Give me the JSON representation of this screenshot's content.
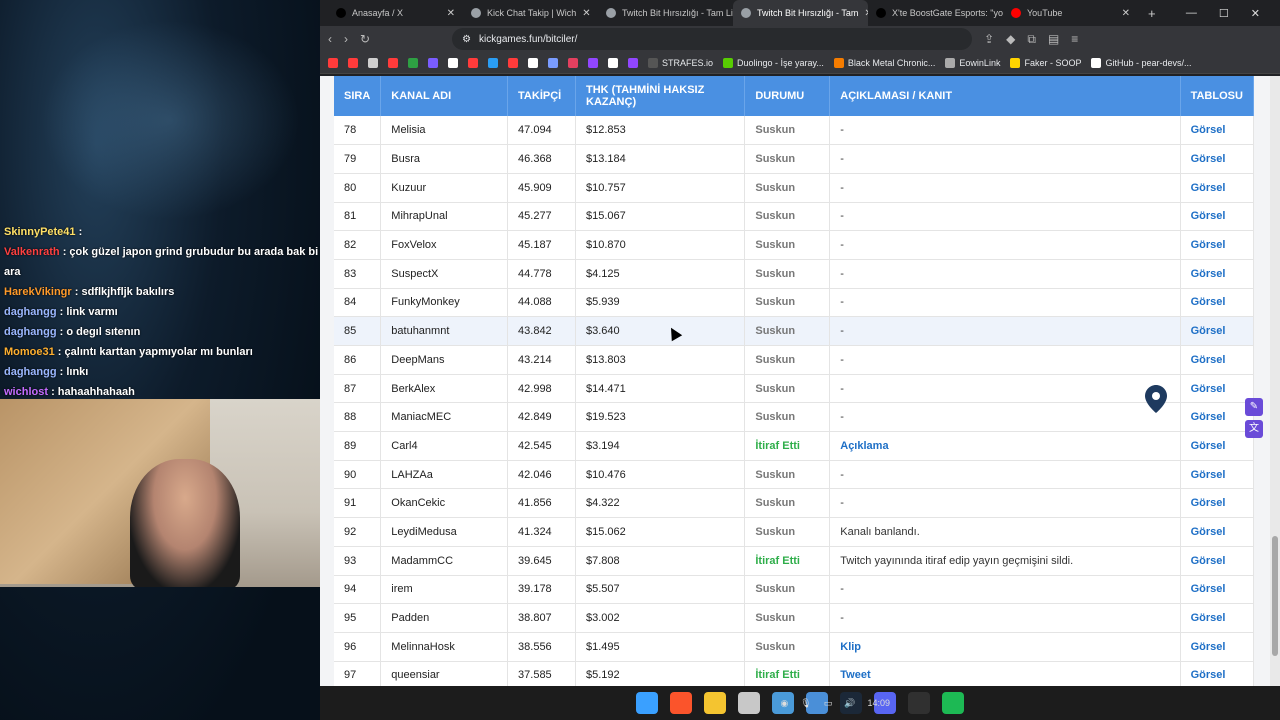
{
  "chat": [
    {
      "user": "SkinnyPete41",
      "color": "#ffe066",
      "msg": ""
    },
    {
      "user": "Valkenrath",
      "color": "#ff4040",
      "msg": "çok güzel japon grind grubudur bu arada bak bi ara"
    },
    {
      "user": "HarekVikingr",
      "color": "#ff9a2a",
      "msg": "sdflkjhfljk bakılırs"
    },
    {
      "user": "daghangg",
      "color": "#9bb7ff",
      "msg": "link varmı"
    },
    {
      "user": "daghangg",
      "color": "#9bb7ff",
      "msg": "o degıl sıtenın"
    },
    {
      "user": "Momoe31",
      "color": "#ffb030",
      "msg": "çalıntı karttan yapmıyolar mı bunları"
    },
    {
      "user": "daghangg",
      "color": "#9bb7ff",
      "msg": "lınkı"
    },
    {
      "user": "wichlost",
      "color": "#c56bff",
      "msg": "hahaahhahaah"
    }
  ],
  "browser": {
    "tabs": [
      {
        "title": "Anasayfa / X",
        "color": "#000000",
        "active": false
      },
      {
        "title": "Kick Chat Takip | Wich",
        "color": "#9aa0a6",
        "active": false
      },
      {
        "title": "Twitch Bit Hırsızlığı - Tam List",
        "color": "#9aa0a6",
        "active": false
      },
      {
        "title": "Twitch Bit Hırsızlığı - Tam",
        "color": "#9aa0a6",
        "active": true
      },
      {
        "title": "X'te BoostGate Esports: \"yok",
        "color": "#000000",
        "active": false
      },
      {
        "title": "YouTube",
        "color": "#ff0000",
        "active": false
      }
    ],
    "url": "kickgames.fun/bitciler/",
    "bookmarks": [
      {
        "label": "",
        "color": "#ff3b3b"
      },
      {
        "label": "",
        "color": "#ff3b3b"
      },
      {
        "label": "",
        "color": "#cfcfcf"
      },
      {
        "label": "",
        "color": "#ff3b3b"
      },
      {
        "label": "",
        "color": "#2ea043"
      },
      {
        "label": "",
        "color": "#7a5cff"
      },
      {
        "label": "",
        "color": "#ffffff"
      },
      {
        "label": "",
        "color": "#ff3b3b"
      },
      {
        "label": "",
        "color": "#2a9df4"
      },
      {
        "label": "",
        "color": "#ff3b3b"
      },
      {
        "label": "",
        "color": "#ffffff"
      },
      {
        "label": "",
        "color": "#7a9cff"
      },
      {
        "label": "",
        "color": "#e4405f"
      },
      {
        "label": "",
        "color": "#9146ff"
      },
      {
        "label": "",
        "color": "#ffffff"
      },
      {
        "label": "",
        "color": "#9146ff"
      },
      {
        "label": "STRAFES.io",
        "color": "#555555"
      },
      {
        "label": "Duolingo - İşe yaray...",
        "color": "#58cc02"
      },
      {
        "label": "Black Metal Chronic...",
        "color": "#f57c00"
      },
      {
        "label": "EowinLink",
        "color": "#aaaaaa"
      },
      {
        "label": "Faker - SOOP",
        "color": "#ffd400"
      },
      {
        "label": "GitHub - pear-devs/...",
        "color": "#ffffff"
      }
    ]
  },
  "table": {
    "headers": [
      "SIRA",
      "KANAL ADI",
      "TAKİPÇİ",
      "THK (TAHMİNİ HAKSIZ KAZANÇ)",
      "DURUMU",
      "AÇIKLAMASI / KANIT",
      "TABLOSU"
    ],
    "rows": [
      {
        "sira": "78",
        "kanal": "Melisia",
        "takipci": "47.094",
        "thk": "$12.853",
        "durum": "Suskun",
        "aciklama": "-",
        "tablo": "Görsel"
      },
      {
        "sira": "79",
        "kanal": "Busra",
        "takipci": "46.368",
        "thk": "$13.184",
        "durum": "Suskun",
        "aciklama": "-",
        "tablo": "Görsel"
      },
      {
        "sira": "80",
        "kanal": "Kuzuur",
        "takipci": "45.909",
        "thk": "$10.757",
        "durum": "Suskun",
        "aciklama": "-",
        "tablo": "Görsel"
      },
      {
        "sira": "81",
        "kanal": "MihrapUnal",
        "takipci": "45.277",
        "thk": "$15.067",
        "durum": "Suskun",
        "aciklama": "-",
        "tablo": "Görsel"
      },
      {
        "sira": "82",
        "kanal": "FoxVelox",
        "takipci": "45.187",
        "thk": "$10.870",
        "durum": "Suskun",
        "aciklama": "-",
        "tablo": "Görsel"
      },
      {
        "sira": "83",
        "kanal": "SuspectX",
        "takipci": "44.778",
        "thk": "$4.125",
        "durum": "Suskun",
        "aciklama": "-",
        "tablo": "Görsel"
      },
      {
        "sira": "84",
        "kanal": "FunkyMonkey",
        "takipci": "44.088",
        "thk": "$5.939",
        "durum": "Suskun",
        "aciklama": "-",
        "tablo": "Görsel"
      },
      {
        "sira": "85",
        "kanal": "batuhanmnt",
        "takipci": "43.842",
        "thk": "$3.640",
        "durum": "Suskun",
        "aciklama": "-",
        "tablo": "Görsel",
        "highlight": true
      },
      {
        "sira": "86",
        "kanal": "DeepMans",
        "takipci": "43.214",
        "thk": "$13.803",
        "durum": "Suskun",
        "aciklama": "-",
        "tablo": "Görsel"
      },
      {
        "sira": "87",
        "kanal": "BerkAlex",
        "takipci": "42.998",
        "thk": "$14.471",
        "durum": "Suskun",
        "aciklama": "-",
        "tablo": "Görsel"
      },
      {
        "sira": "88",
        "kanal": "ManiacMEC",
        "takipci": "42.849",
        "thk": "$19.523",
        "durum": "Suskun",
        "aciklama": "-",
        "tablo": "Görsel"
      },
      {
        "sira": "89",
        "kanal": "Carl4",
        "takipci": "42.545",
        "thk": "$3.194",
        "durum": "İtiraf Etti",
        "aciklama": "Açıklama",
        "aciklama_link": true,
        "tablo": "Görsel"
      },
      {
        "sira": "90",
        "kanal": "LAHZAa",
        "takipci": "42.046",
        "thk": "$10.476",
        "durum": "Suskun",
        "aciklama": "-",
        "tablo": "Görsel"
      },
      {
        "sira": "91",
        "kanal": "OkanCekic",
        "takipci": "41.856",
        "thk": "$4.322",
        "durum": "Suskun",
        "aciklama": "-",
        "tablo": "Görsel"
      },
      {
        "sira": "92",
        "kanal": "LeydiMedusa",
        "takipci": "41.324",
        "thk": "$15.062",
        "durum": "Suskun",
        "aciklama": "Kanalı banlandı.",
        "tablo": "Görsel"
      },
      {
        "sira": "93",
        "kanal": "MadammCC",
        "takipci": "39.645",
        "thk": "$7.808",
        "durum": "İtiraf Etti",
        "aciklama": "Twitch yayınında itiraf edip yayın geçmişini sildi.",
        "tablo": "Görsel"
      },
      {
        "sira": "94",
        "kanal": "irem",
        "takipci": "39.178",
        "thk": "$5.507",
        "durum": "Suskun",
        "aciklama": "-",
        "tablo": "Görsel"
      },
      {
        "sira": "95",
        "kanal": "Padden",
        "takipci": "38.807",
        "thk": "$3.002",
        "durum": "Suskun",
        "aciklama": "-",
        "tablo": "Görsel"
      },
      {
        "sira": "96",
        "kanal": "MelinnaHosk",
        "takipci": "38.556",
        "thk": "$1.495",
        "durum": "Suskun",
        "aciklama": "Klip",
        "aciklama_link": true,
        "tablo": "Görsel"
      },
      {
        "sira": "97",
        "kanal": "queensiar",
        "takipci": "37.585",
        "thk": "$5.192",
        "durum": "İtiraf Etti",
        "aciklama": "Tweet",
        "aciklama_link": true,
        "tablo": "Görsel"
      }
    ]
  },
  "taskbar": {
    "apps": [
      {
        "name": "windows-start",
        "color": "#3aa0ff"
      },
      {
        "name": "brave",
        "color": "#fb542b"
      },
      {
        "name": "file-explorer",
        "color": "#f4c430"
      },
      {
        "name": "tool",
        "color": "#c8c8c8"
      },
      {
        "name": "photos",
        "color": "#4a9ad8"
      },
      {
        "name": "app-blue",
        "color": "#4a8fd8"
      },
      {
        "name": "steam",
        "color": "#1b2838"
      },
      {
        "name": "discord",
        "color": "#5865f2"
      },
      {
        "name": "obs",
        "color": "#303030"
      },
      {
        "name": "spotify",
        "color": "#1db954"
      }
    ],
    "time": "14:09"
  }
}
